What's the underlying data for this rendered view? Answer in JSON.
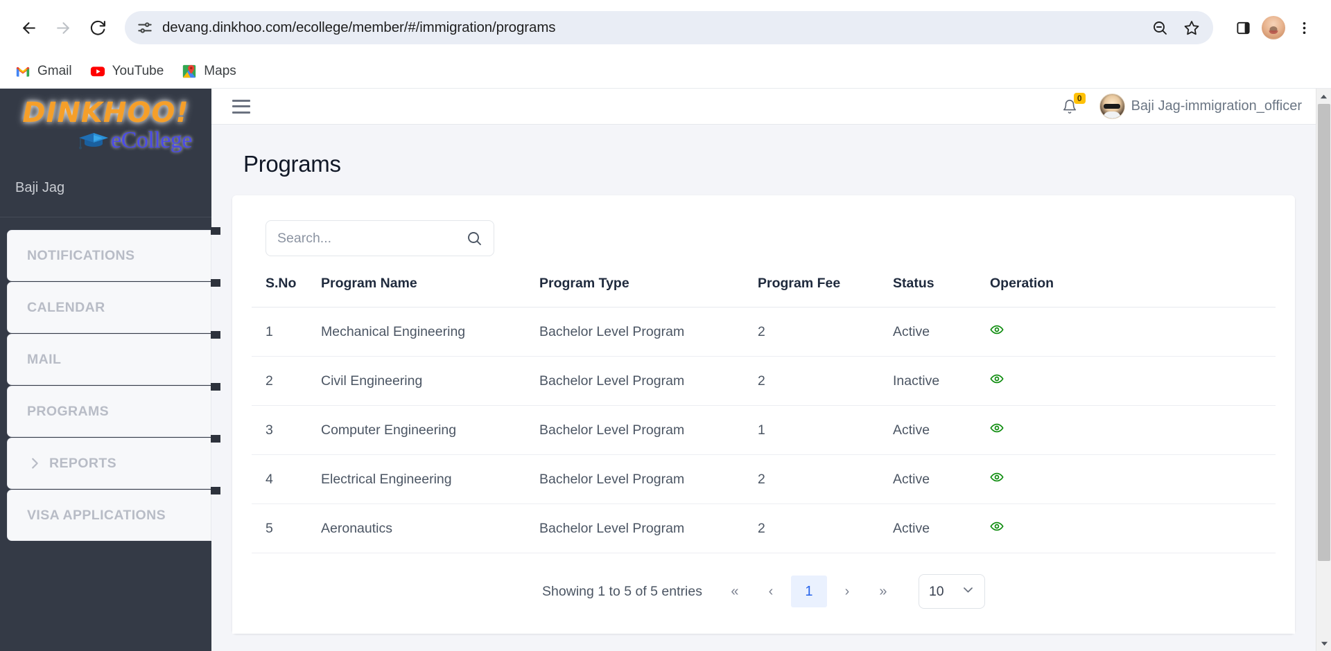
{
  "browser": {
    "back_label": "Back",
    "forward_label": "Forward",
    "reload_label": "Reload",
    "site_info_icon": "tune-icon",
    "url": "devang.dinkhoo.com/ecollege/member/#/immigration/programs",
    "zoom_out_icon": "zoom-out-icon",
    "bookmark_icon": "star-icon",
    "side_panel_icon": "side-panel-icon",
    "profile_icon": "profile-avatar-icon",
    "menu_icon": "three-dot-menu-icon",
    "bookmarks": [
      {
        "label": "Gmail",
        "icon": "gmail-icon"
      },
      {
        "label": "YouTube",
        "icon": "youtube-icon"
      },
      {
        "label": "Maps",
        "icon": "google-maps-icon"
      }
    ]
  },
  "sidebar": {
    "brand_name": "DINKHOO!",
    "brand_sub": "eCollege",
    "user": "Baji Jag",
    "items": [
      {
        "label": "NOTIFICATIONS",
        "icon": null
      },
      {
        "label": "CALENDAR",
        "icon": null
      },
      {
        "label": "MAIL",
        "icon": null
      },
      {
        "label": "PROGRAMS",
        "icon": null
      },
      {
        "label": "REPORTS",
        "icon": "chevron-right-icon"
      },
      {
        "label": "VISA APPLICATIONS",
        "icon": null
      }
    ]
  },
  "header": {
    "menu_toggle_icon": "hamburger-icon",
    "notification_icon": "bell-icon",
    "notification_count": "0",
    "user_name": "Baji Jag-immigration_officer",
    "avatar_icon": "user-avatar-icon"
  },
  "main": {
    "title": "Programs",
    "search": {
      "placeholder": "Search...",
      "value": "",
      "icon": "search-icon"
    },
    "table": {
      "columns": [
        "S.No",
        "Program Name",
        "Program Type",
        "Program Fee",
        "Status",
        "Operation"
      ],
      "rows": [
        {
          "sno": "1",
          "name": "Mechanical Engineering",
          "type": "Bachelor Level Program",
          "fee": "2",
          "status": "Active",
          "op_icon": "eye-icon"
        },
        {
          "sno": "2",
          "name": "Civil Engineering",
          "type": "Bachelor Level Program",
          "fee": "2",
          "status": "Inactive",
          "op_icon": "eye-icon"
        },
        {
          "sno": "3",
          "name": "Computer Engineering",
          "type": "Bachelor Level Program",
          "fee": "1",
          "status": "Active",
          "op_icon": "eye-icon"
        },
        {
          "sno": "4",
          "name": "Electrical Engineering",
          "type": "Bachelor Level Program",
          "fee": "2",
          "status": "Active",
          "op_icon": "eye-icon"
        },
        {
          "sno": "5",
          "name": "Aeronautics",
          "type": "Bachelor Level Program",
          "fee": "2",
          "status": "Active",
          "op_icon": "eye-icon"
        }
      ]
    },
    "pagination": {
      "info": "Showing 1 to 5 of 5 entries",
      "first_label": "«",
      "prev_label": "‹",
      "current_page": "1",
      "next_label": "›",
      "last_label": "»",
      "page_size": "10"
    }
  },
  "colors": {
    "sidebar_bg": "#343a46",
    "accent_blue": "#2563eb",
    "eye_green": "#0a8a0a",
    "badge_yellow": "#ffc107",
    "brand_orange": "#f59f2a",
    "brand_blue": "#4a4ae8"
  }
}
